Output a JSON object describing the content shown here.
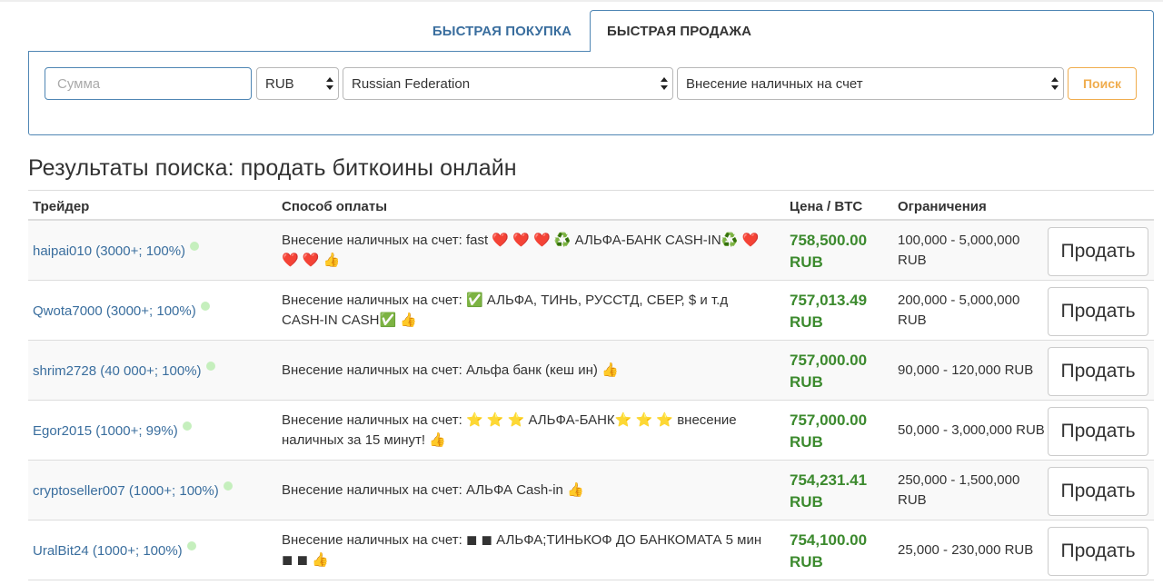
{
  "tabs": {
    "buy_label": "БЫСТРАЯ ПОКУПКА",
    "sell_label": "БЫСТРАЯ ПРОДАЖА"
  },
  "filters": {
    "amount_placeholder": "Сумма",
    "currency_value": "RUB",
    "country_value": "Russian Federation",
    "method_value": "Внесение наличных на счет",
    "search_label": "Поиск"
  },
  "results": {
    "heading": "Результаты поиска: продать биткоины онлайн",
    "columns": {
      "trader": "Трейдер",
      "payment": "Способ оплаты",
      "price": "Цена / BTC",
      "limits": "Ограничения"
    },
    "sell_label": "Продать",
    "rows": [
      {
        "trader": "haipai010 (3000+; 100%)",
        "payment": "Внесение наличных на счет: fast ❤️ ❤️ ❤️ ♻️  АЛЬФА-БАНК CASH-IN♻️ ❤️ ❤️ ❤️ 👍",
        "price": "758,500.00",
        "currency": "RUB",
        "limits": "100,000 - 5,000,000 RUB"
      },
      {
        "trader": "Qwota7000 (3000+; 100%)",
        "payment": "Внесение наличных на счет: ✅ АЛЬФА, ТИНЬ, РУССТД, СБЕР, $ и т.д CASH-IN CASH✅ 👍",
        "price": "757,013.49",
        "currency": "RUB",
        "limits": "200,000 - 5,000,000 RUB"
      },
      {
        "trader": "shrim2728 (40 000+; 100%)",
        "payment": "Внесение наличных на счет: Альфа банк (кеш ин) 👍",
        "price": "757,000.00",
        "currency": "RUB",
        "limits": "90,000 - 120,000 RUB"
      },
      {
        "trader": "Egor2015 (1000+; 99%)",
        "payment": "Внесение наличных на счет: ⭐ ⭐ ⭐ АЛЬФА-БАНК⭐ ⭐ ⭐  внесение наличных за 15 минут! 👍",
        "price": "757,000.00",
        "currency": "RUB",
        "limits": "50,000 - 3,000,000 RUB"
      },
      {
        "trader": "cryptoseller007 (1000+; 100%)",
        "payment": "Внесение наличных на счет: АЛЬФА Cash-in 👍",
        "price": "754,231.41",
        "currency": "RUB",
        "limits": "250,000 - 1,500,000 RUB"
      },
      {
        "trader": "UralBit24 (1000+; 100%)",
        "payment": "Внесение наличных на счет: ◼ ◼ АЛЬФА;ТИНЬКОФ ДО БАНКОМАТА 5 мин ◼ ◼ 👍",
        "price": "754,100.00",
        "currency": "RUB",
        "limits": "25,000 - 230,000 RUB"
      }
    ]
  },
  "colors": {
    "link": "#3a6e9e",
    "price": "#3c8a2e",
    "search_accent": "#f0ad4e",
    "online_dot": "#c5efbd"
  }
}
